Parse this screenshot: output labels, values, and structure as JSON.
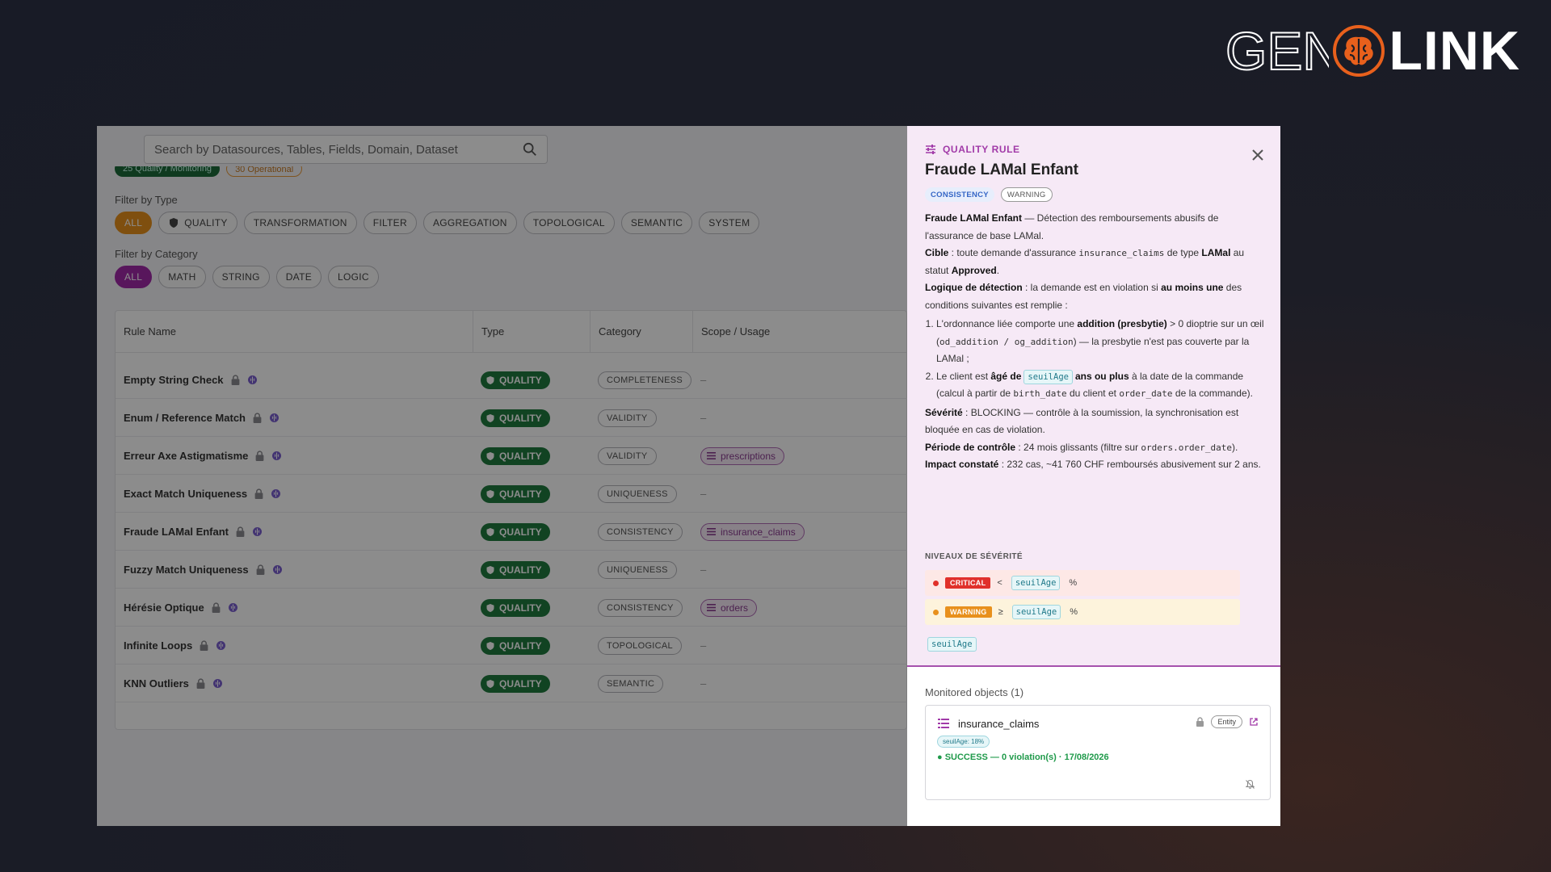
{
  "logo": {
    "part1": "GENI",
    "part2": "LINK"
  },
  "search": {
    "placeholder": "Search by Datasources, Tables, Fields, Domain, Dataset"
  },
  "top_chips": [
    {
      "label": "25 Quality / Monitoring"
    },
    {
      "label": "30 Operational"
    }
  ],
  "filters": {
    "type_label": "Filter by Type",
    "type_chips": [
      "ALL",
      "QUALITY",
      "TRANSFORMATION",
      "FILTER",
      "AGGREGATION",
      "TOPOLOGICAL",
      "SEMANTIC",
      "SYSTEM"
    ],
    "category_label": "Filter by Category",
    "category_chips": [
      "ALL",
      "MATH",
      "STRING",
      "DATE",
      "LOGIC"
    ]
  },
  "table": {
    "headers": [
      "Rule Name",
      "Type",
      "Category",
      "Scope / Usage"
    ],
    "rows": [
      {
        "name": "Empty String Check",
        "type": "QUALITY",
        "category": "COMPLETENESS",
        "scope": "–"
      },
      {
        "name": "Enum / Reference Match",
        "type": "QUALITY",
        "category": "VALIDITY",
        "scope": "–"
      },
      {
        "name": "Erreur Axe Astigmatisme",
        "type": "QUALITY",
        "category": "VALIDITY",
        "scope": "prescriptions"
      },
      {
        "name": "Exact Match Uniqueness",
        "type": "QUALITY",
        "category": "UNIQUENESS",
        "scope": "–"
      },
      {
        "name": "Fraude LAMal Enfant",
        "type": "QUALITY",
        "category": "CONSISTENCY",
        "scope": "insurance_claims"
      },
      {
        "name": "Fuzzy Match Uniqueness",
        "type": "QUALITY",
        "category": "UNIQUENESS",
        "scope": "–"
      },
      {
        "name": "Hérésie Optique",
        "type": "QUALITY",
        "category": "CONSISTENCY",
        "scope": "orders"
      },
      {
        "name": "Infinite Loops",
        "type": "QUALITY",
        "category": "TOPOLOGICAL",
        "scope": "–"
      },
      {
        "name": "KNN Outliers",
        "type": "QUALITY",
        "category": "SEMANTIC",
        "scope": "–"
      }
    ]
  },
  "drawer": {
    "label": "QUALITY RULE",
    "title": "Fraude LAMal Enfant",
    "tags": [
      "CONSISTENCY",
      "WARNING"
    ],
    "desc": {
      "p1_b": "Fraude LAMal Enfant",
      "p1": " — Détection des remboursements abusifs de l'assurance de base LAMal.",
      "p2_b": "Cible",
      "p2_a": " : toute demande d'assurance ",
      "p2_code": "insurance_claims",
      "p2_c": " de type ",
      "p2_b2": "LAMal",
      "p2_d": " au statut ",
      "p2_b3": "Approved",
      "p2_e": ".",
      "p3_b": "Logique de détection",
      "p3_a": " : la demande est en violation si ",
      "p3_b2": "au moins une",
      "p3_c": " des conditions suivantes est remplie :",
      "li1_a": "L'ordonnance liée comporte une ",
      "li1_b": "addition (presbytie)",
      "li1_c": " > 0 dioptrie sur un œil (",
      "li1_code": "od_addition / og_addition",
      "li1_d": ") — la presbytie n'est pas couverte par la LAMal ;",
      "li2_a": "Le client est ",
      "li2_b": "âgé de",
      "li2_pill": "seuilAge",
      "li2_b2": "ans ou plus",
      "li2_c": " à la date de la commande (calcul à partir de ",
      "li2_code1": "birth_date",
      "li2_d": " du client et ",
      "li2_code2": "order_date",
      "li2_e": " de la commande).",
      "p4_b": "Sévérité",
      "p4": " : BLOCKING — contrôle à la soumission, la synchronisation est bloquée en cas de violation.",
      "p5_b": "Période de contrôle",
      "p5_a": " : 24 mois glissants (filtre sur ",
      "p5_code": "orders.order_date",
      "p5_c": ").",
      "p6_b": "Impact constaté",
      "p6": " : 232 cas, ~41 760 CHF remboursés abusivement sur 2 ans."
    },
    "severity_title": "NIVEAUX DE SÉVÉRITÉ",
    "severity": [
      {
        "tag": "CRITICAL",
        "op": "<",
        "param": "seuilAge",
        "unit": "%",
        "color": "#e0302a"
      },
      {
        "tag": "WARNING",
        "op": "≥",
        "param": "seuilAge",
        "unit": "%",
        "color": "#e8901c"
      }
    ],
    "param": "seuilAge",
    "monitored_title": "Monitored objects (1)",
    "monitored": {
      "name": "insurance_claims",
      "entity": "Entity",
      "seuil": "seuilAge: 18%",
      "status": "● SUCCESS — 0 violation(s) · 17/08/2026"
    }
  },
  "colors": {
    "accent_purple": "#a129a8",
    "accent_orange": "#e8901c",
    "quality_green": "#1f7a3e"
  }
}
